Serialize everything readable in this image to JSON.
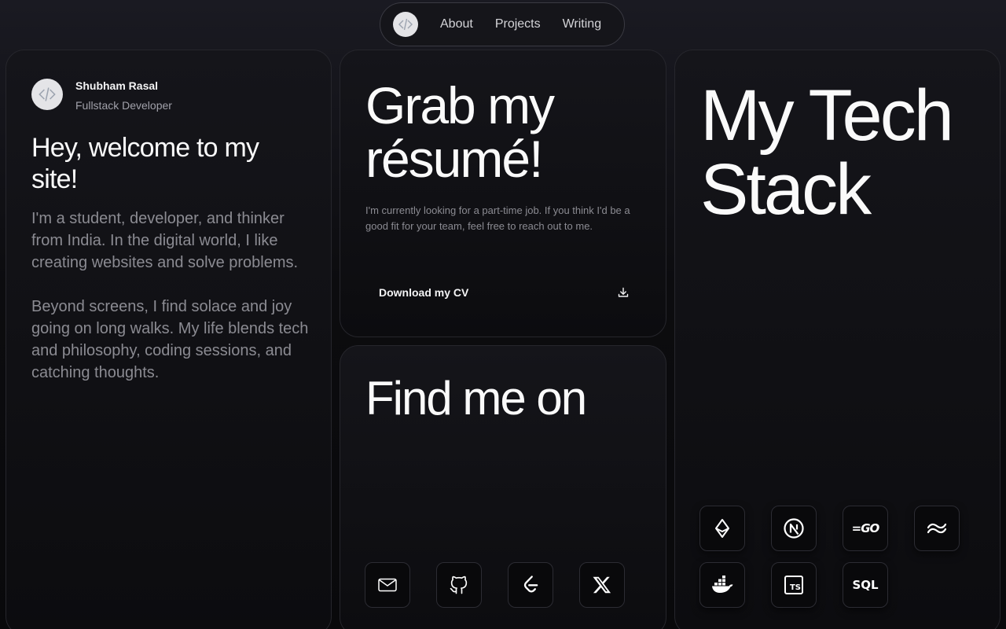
{
  "nav": {
    "logo_icon": "code-brackets-icon",
    "items": [
      {
        "label": "About"
      },
      {
        "label": "Projects"
      },
      {
        "label": "Writing"
      }
    ]
  },
  "profile": {
    "avatar_icon": "code-brackets-icon",
    "name": "Shubham Rasal",
    "role": "Fullstack Developer",
    "heading": "Hey, welcome to my site!",
    "bio_1": "I'm a student, developer, and thinker from India. In the digital world, I like creating websites and solve problems.",
    "bio_2": "Beyond screens, I find solace and joy going on long walks. My life blends tech and philosophy, coding sessions, and catching thoughts."
  },
  "resume": {
    "title": "Grab my résumé!",
    "text": "I'm currently looking for a part-time job. If you think I'd be a good fit for your team, feel free to reach out to me.",
    "download_label": "Download my CV",
    "download_icon": "download-icon"
  },
  "find": {
    "title": "Find me on",
    "links": [
      {
        "icon": "mail-icon"
      },
      {
        "icon": "github-icon"
      },
      {
        "icon": "leetcode-icon"
      },
      {
        "icon": "x-twitter-icon"
      }
    ]
  },
  "stack": {
    "title": "My Tech Stack",
    "items": [
      {
        "icon": "ethereum-icon"
      },
      {
        "icon": "nextjs-icon"
      },
      {
        "icon": "golang-icon",
        "text": "=GO"
      },
      {
        "icon": "tailwind-icon"
      },
      {
        "icon": "docker-icon"
      },
      {
        "icon": "typescript-icon",
        "text": "TS"
      },
      {
        "icon": "sql-icon",
        "text": "SQL"
      }
    ]
  },
  "colors": {
    "background": "#0b0b0d",
    "card_border": "#26262c",
    "muted_text": "#8b8b92",
    "logo_fill": "#e4e4e7"
  }
}
